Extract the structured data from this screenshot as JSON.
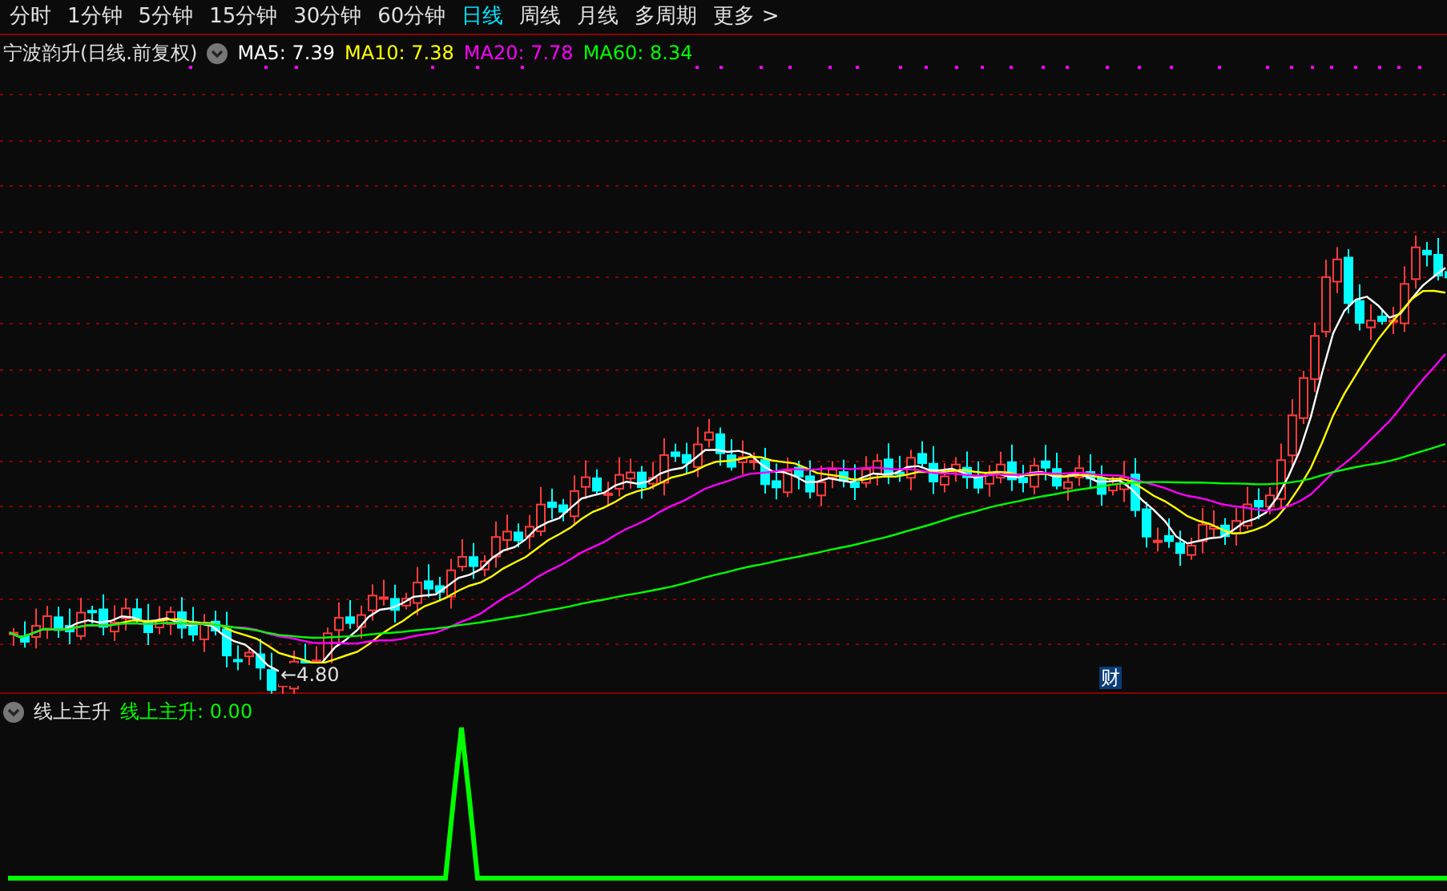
{
  "periods": [
    {
      "label": "分时",
      "selected": false
    },
    {
      "label": "1分钟",
      "selected": false
    },
    {
      "label": "5分钟",
      "selected": false
    },
    {
      "label": "15分钟",
      "selected": false
    },
    {
      "label": "30分钟",
      "selected": false
    },
    {
      "label": "60分钟",
      "selected": false
    },
    {
      "label": "日线",
      "selected": true
    },
    {
      "label": "周线",
      "selected": false
    },
    {
      "label": "月线",
      "selected": false
    },
    {
      "label": "多周期",
      "selected": false
    },
    {
      "label": "更多 >",
      "selected": false
    }
  ],
  "main_chart": {
    "title": "宁波韵升(日线.前复权)",
    "legend": [
      {
        "label": "MA5: 7.39",
        "color": "#ffffff"
      },
      {
        "label": "MA10: 7.38",
        "color": "#ffff00"
      },
      {
        "label": "MA20: 7.78",
        "color": "#ff00ff"
      },
      {
        "label": "MA60: 8.34",
        "color": "#00ff00"
      }
    ],
    "low_label": "←4.80",
    "event_badge": "财"
  },
  "indicator": {
    "title": "线上主升",
    "legend": [
      {
        "label": "线上主升: 0.00",
        "color": "#00ff00"
      }
    ]
  }
}
